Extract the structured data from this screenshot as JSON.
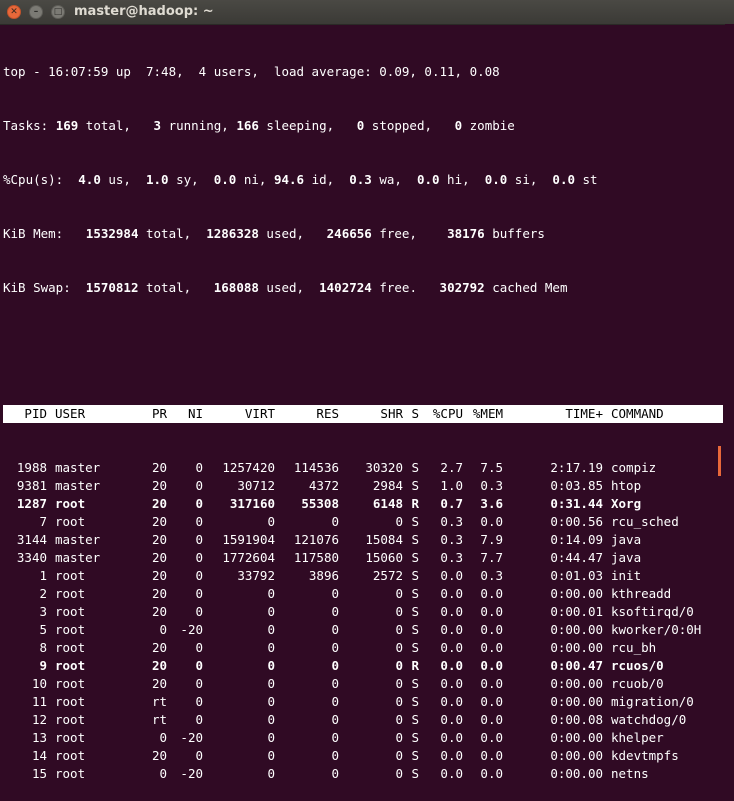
{
  "window": {
    "title": "master@hadoop: ~",
    "close_glyph": "✕",
    "minimize_glyph": "–",
    "maximize_glyph": "□"
  },
  "summary": {
    "line1": "top - 16:07:59 up  7:48,  4 users,  load average: 0.09, 0.11, 0.08",
    "tasks": {
      "prefix": "Tasks: ",
      "total": "169",
      "t1": " total,   ",
      "running": "3",
      "t2": " running, ",
      "sleeping": "166",
      "t3": " sleeping,   ",
      "stopped": "0",
      "t4": " stopped,   ",
      "zombie": "0",
      "t5": " zombie"
    },
    "cpu": {
      "prefix": "%Cpu(s):  ",
      "us": "4.0",
      "t1": " us,  ",
      "sy": "1.0",
      "t2": " sy,  ",
      "ni": "0.0",
      "t3": " ni, ",
      "id": "94.6",
      "t4": " id,  ",
      "wa": "0.3",
      "t5": " wa,  ",
      "hi": "0.0",
      "t6": " hi,  ",
      "si": "0.0",
      "t7": " si,  ",
      "st": "0.0",
      "t8": " st"
    },
    "mem": {
      "prefix": "KiB Mem:   ",
      "total": "1532984",
      "t1": " total,  ",
      "used": "1286328",
      "t2": " used,   ",
      "free": "246656",
      "t3": " free,    ",
      "buffers": "38176",
      "t4": " buffers"
    },
    "swap": {
      "prefix": "KiB Swap:  ",
      "total": "1570812",
      "t1": " total,   ",
      "used": "168088",
      "t2": " used,  ",
      "free": "1402724",
      "t3": " free.   ",
      "cached": "302792",
      "t4": " cached Mem"
    }
  },
  "table": {
    "headers": {
      "pid": "PID",
      "user": "USER",
      "pr": "PR",
      "ni": "NI",
      "virt": "VIRT",
      "res": "RES",
      "shr": "SHR",
      "s": "S",
      "cpu": "%CPU",
      "mem": "%MEM",
      "time": "TIME+",
      "command": "COMMAND"
    },
    "rows": [
      {
        "pid": "1988",
        "user": "master",
        "pr": "20",
        "ni": "0",
        "virt": "1257420",
        "res": "114536",
        "shr": "30320",
        "s": "S",
        "cpu": "2.7",
        "mem": "7.5",
        "time": "2:17.19",
        "command": "compiz",
        "bold": false
      },
      {
        "pid": "9381",
        "user": "master",
        "pr": "20",
        "ni": "0",
        "virt": "30712",
        "res": "4372",
        "shr": "2984",
        "s": "S",
        "cpu": "1.0",
        "mem": "0.3",
        "time": "0:03.85",
        "command": "htop",
        "bold": false
      },
      {
        "pid": "1287",
        "user": "root",
        "pr": "20",
        "ni": "0",
        "virt": "317160",
        "res": "55308",
        "shr": "6148",
        "s": "R",
        "cpu": "0.7",
        "mem": "3.6",
        "time": "0:31.44",
        "command": "Xorg",
        "bold": true
      },
      {
        "pid": "7",
        "user": "root",
        "pr": "20",
        "ni": "0",
        "virt": "0",
        "res": "0",
        "shr": "0",
        "s": "S",
        "cpu": "0.3",
        "mem": "0.0",
        "time": "0:00.56",
        "command": "rcu_sched",
        "bold": false
      },
      {
        "pid": "3144",
        "user": "master",
        "pr": "20",
        "ni": "0",
        "virt": "1591904",
        "res": "121076",
        "shr": "15084",
        "s": "S",
        "cpu": "0.3",
        "mem": "7.9",
        "time": "0:14.09",
        "command": "java",
        "bold": false
      },
      {
        "pid": "3340",
        "user": "master",
        "pr": "20",
        "ni": "0",
        "virt": "1772604",
        "res": "117580",
        "shr": "15060",
        "s": "S",
        "cpu": "0.3",
        "mem": "7.7",
        "time": "0:44.47",
        "command": "java",
        "bold": false
      },
      {
        "pid": "1",
        "user": "root",
        "pr": "20",
        "ni": "0",
        "virt": "33792",
        "res": "3896",
        "shr": "2572",
        "s": "S",
        "cpu": "0.0",
        "mem": "0.3",
        "time": "0:01.03",
        "command": "init",
        "bold": false
      },
      {
        "pid": "2",
        "user": "root",
        "pr": "20",
        "ni": "0",
        "virt": "0",
        "res": "0",
        "shr": "0",
        "s": "S",
        "cpu": "0.0",
        "mem": "0.0",
        "time": "0:00.00",
        "command": "kthreadd",
        "bold": false
      },
      {
        "pid": "3",
        "user": "root",
        "pr": "20",
        "ni": "0",
        "virt": "0",
        "res": "0",
        "shr": "0",
        "s": "S",
        "cpu": "0.0",
        "mem": "0.0",
        "time": "0:00.01",
        "command": "ksoftirqd/0",
        "bold": false
      },
      {
        "pid": "5",
        "user": "root",
        "pr": "0",
        "ni": "-20",
        "virt": "0",
        "res": "0",
        "shr": "0",
        "s": "S",
        "cpu": "0.0",
        "mem": "0.0",
        "time": "0:00.00",
        "command": "kworker/0:0H",
        "bold": false
      },
      {
        "pid": "8",
        "user": "root",
        "pr": "20",
        "ni": "0",
        "virt": "0",
        "res": "0",
        "shr": "0",
        "s": "S",
        "cpu": "0.0",
        "mem": "0.0",
        "time": "0:00.00",
        "command": "rcu_bh",
        "bold": false
      },
      {
        "pid": "9",
        "user": "root",
        "pr": "20",
        "ni": "0",
        "virt": "0",
        "res": "0",
        "shr": "0",
        "s": "R",
        "cpu": "0.0",
        "mem": "0.0",
        "time": "0:00.47",
        "command": "rcuos/0",
        "bold": true
      },
      {
        "pid": "10",
        "user": "root",
        "pr": "20",
        "ni": "0",
        "virt": "0",
        "res": "0",
        "shr": "0",
        "s": "S",
        "cpu": "0.0",
        "mem": "0.0",
        "time": "0:00.00",
        "command": "rcuob/0",
        "bold": false
      },
      {
        "pid": "11",
        "user": "root",
        "pr": "rt",
        "ni": "0",
        "virt": "0",
        "res": "0",
        "shr": "0",
        "s": "S",
        "cpu": "0.0",
        "mem": "0.0",
        "time": "0:00.00",
        "command": "migration/0",
        "bold": false
      },
      {
        "pid": "12",
        "user": "root",
        "pr": "rt",
        "ni": "0",
        "virt": "0",
        "res": "0",
        "shr": "0",
        "s": "S",
        "cpu": "0.0",
        "mem": "0.0",
        "time": "0:00.08",
        "command": "watchdog/0",
        "bold": false
      },
      {
        "pid": "13",
        "user": "root",
        "pr": "0",
        "ni": "-20",
        "virt": "0",
        "res": "0",
        "shr": "0",
        "s": "S",
        "cpu": "0.0",
        "mem": "0.0",
        "time": "0:00.00",
        "command": "khelper",
        "bold": false
      },
      {
        "pid": "14",
        "user": "root",
        "pr": "20",
        "ni": "0",
        "virt": "0",
        "res": "0",
        "shr": "0",
        "s": "S",
        "cpu": "0.0",
        "mem": "0.0",
        "time": "0:00.00",
        "command": "kdevtmpfs",
        "bold": false
      },
      {
        "pid": "15",
        "user": "root",
        "pr": "0",
        "ni": "-20",
        "virt": "0",
        "res": "0",
        "shr": "0",
        "s": "S",
        "cpu": "0.0",
        "mem": "0.0",
        "time": "0:00.00",
        "command": "netns",
        "bold": false
      }
    ]
  },
  "colors": {
    "background": "#300a24",
    "foreground": "#ffffff",
    "header_bg": "#ffffff",
    "header_fg": "#000000",
    "close_button": "#e8683a"
  }
}
